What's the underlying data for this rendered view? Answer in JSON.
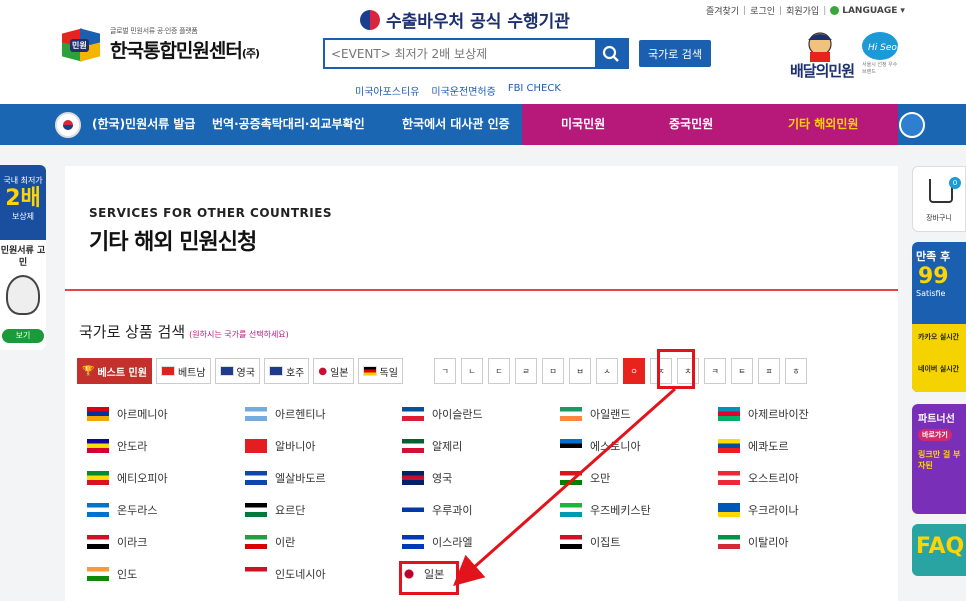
{
  "header": {
    "logo_small": "글로벌 민원서류 공·인증 플랫폼",
    "logo_mark": "민원",
    "logo_title": "한국통합민원센터",
    "logo_suffix": "(주)",
    "slogan": "수출바우처 공식 수행기관",
    "search_placeholder": "<EVENT> 최저가 2배 보상제",
    "country_search_label": "국가로 검색",
    "quick_links": [
      "미국아포스티유",
      "미국운전면허증",
      "FBI CHECK"
    ],
    "top_links": [
      "즐겨찾기",
      "로그인",
      "회원가입"
    ],
    "language_label": "LANGUAGE",
    "delivery_logo": "배달의민원",
    "delivery_sub": "서울시 선정 우수 브랜드",
    "delivery_badge": "Hi Seoul"
  },
  "nav": {
    "items": [
      "(한국)민원서류 발급",
      "번역·공증촉탁대리·외교부확인",
      "한국에서 대사관 인증",
      "미국민원",
      "중국민원",
      "기타 해외민원"
    ]
  },
  "left_banner": {
    "top_text": "국내 최저가",
    "top_num": "2배",
    "top_bottom": "보상제",
    "mid_text": "민원서류 고민",
    "button": "보기"
  },
  "main": {
    "eng_title": "SERVICES FOR OTHER COUNTRIES",
    "kor_title": "기타 해외 민원신청",
    "search_title": "국가로 상품 검색",
    "search_hint": "(원하시는 국가를 선택하세요)",
    "filters": [
      {
        "label": "베스트 민원",
        "icon": "trophy-icon"
      },
      {
        "label": "베트남",
        "color": "#da251d"
      },
      {
        "label": "영국",
        "color": "#1f3a8a"
      },
      {
        "label": "호주",
        "color": "#1f3a8a"
      },
      {
        "label": "일본",
        "color": "#ffffff"
      },
      {
        "label": "독일",
        "color": "#000000"
      }
    ],
    "consonants": [
      "ㄱ",
      "ㄴ",
      "ㄷ",
      "ㄹ",
      "ㅁ",
      "ㅂ",
      "ㅅ",
      "ㅇ",
      "ㅈ",
      "ㅊ",
      "ㅋ",
      "ㅌ",
      "ㅍ",
      "ㅎ"
    ],
    "active_consonant": "ㅇ",
    "countries": [
      [
        "아르메니아",
        "아르헨티나",
        "아이슬란드",
        "아일랜드",
        "아제르바이잔"
      ],
      [
        "안도라",
        "알바니아",
        "알제리",
        "에스토니아",
        "에콰도르"
      ],
      [
        "에티오피아",
        "엘살바도르",
        "영국",
        "오만",
        "오스트리아"
      ],
      [
        "온두라스",
        "요르단",
        "우루과이",
        "우즈베키스탄",
        "우크라이나"
      ],
      [
        "이라크",
        "이란",
        "이스라엘",
        "이집트",
        "이탈리아"
      ],
      [
        "인도",
        "인도네시아",
        "일본"
      ]
    ]
  },
  "right_bar": {
    "cart_label": "장바구니",
    "cart_count": "0",
    "promo1_top": "만족 후",
    "promo1_num": "99",
    "promo1_sub": "Satisfie",
    "kakao": "카카오 실시간",
    "naver": "네이버 실시간",
    "promo2_title": "파트너선",
    "promo2_tag": "바로가기",
    "promo2_sub": "링크만 걸 부자된",
    "faq": "FAQ"
  },
  "colors": {
    "nav_blue": "#1b66b3",
    "nav_pink": "#b6197a",
    "accent_red": "#e3131b",
    "brand_blue": "#1b5fb0"
  }
}
